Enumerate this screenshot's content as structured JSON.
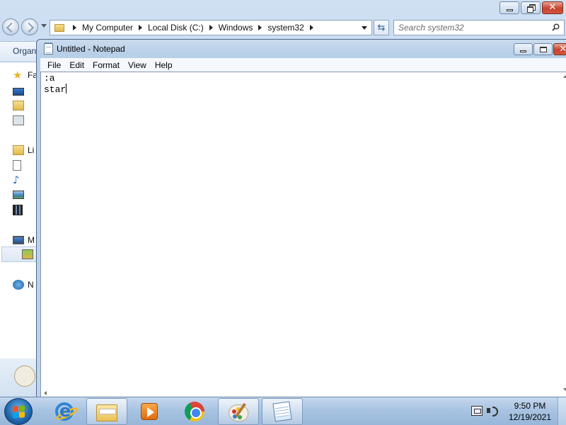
{
  "explorer": {
    "breadcrumbs": [
      "My Computer",
      "Local Disk (C:)",
      "Windows",
      "system32"
    ],
    "search_placeholder": "Search system32",
    "organize_label": "Organ",
    "nav_labels": {
      "favorites": "Fa",
      "libraries": "Li",
      "computer": "M",
      "network": "N"
    }
  },
  "notepad": {
    "title": "Untitled - Notepad",
    "menu": [
      "File",
      "Edit",
      "Format",
      "View",
      "Help"
    ],
    "content_lines": [
      ":a",
      "star"
    ]
  },
  "taskbar": {
    "pinned": [
      "internet-explorer",
      "windows-explorer",
      "windows-media-player",
      "google-chrome",
      "paint",
      "notepad"
    ],
    "clock_time": "9:50 PM",
    "clock_date": "12/19/2021"
  },
  "colors": {
    "taskbar": "#a9c4e2",
    "window_frame": "#b8cfe8",
    "close_button": "#c7432d"
  }
}
